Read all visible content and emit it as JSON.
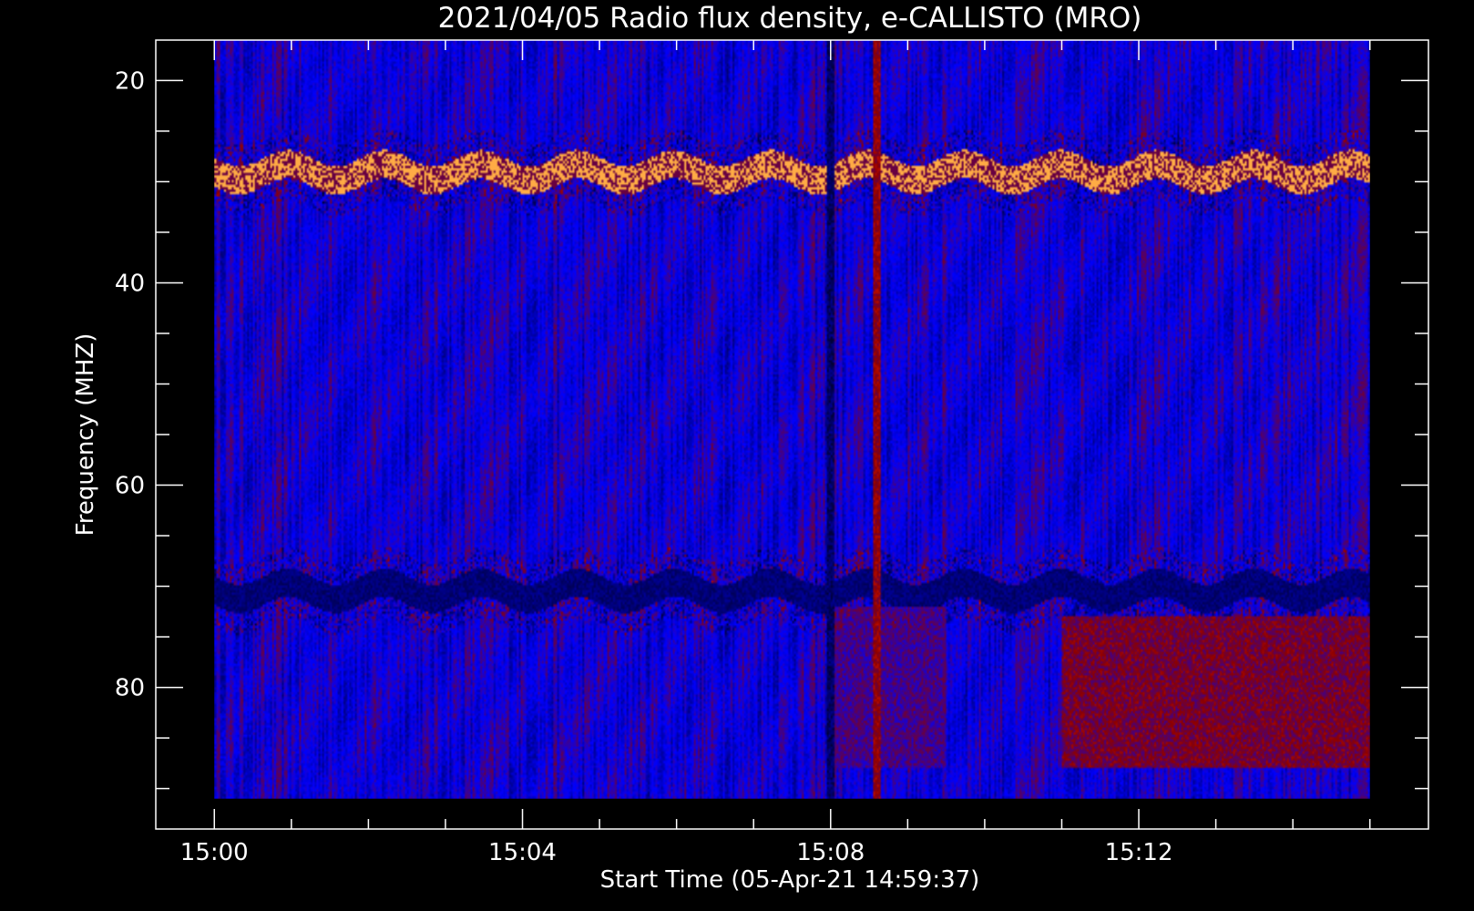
{
  "chart_data": {
    "type": "heatmap",
    "title": "2021/04/05  Radio flux density, e-CALLISTO (MRO)",
    "xlabel": "Start Time (05-Apr-21 14:59:37)",
    "ylabel": "Frequency (MHZ)",
    "x_ticks": [
      {
        "minute": 0,
        "label": "15:00"
      },
      {
        "minute": 4,
        "label": "15:04"
      },
      {
        "minute": 8,
        "label": "15:08"
      },
      {
        "minute": 12,
        "label": "15:12"
      }
    ],
    "y_ticks": [
      {
        "mhz": 20,
        "label": "20"
      },
      {
        "mhz": 40,
        "label": "40"
      },
      {
        "mhz": 60,
        "label": "60"
      },
      {
        "mhz": 80,
        "label": "80"
      }
    ],
    "xlim": [
      -0.76,
      15.76
    ],
    "ylim": [
      16,
      94
    ],
    "data_time_range": [
      0,
      15
    ],
    "data_freq_range": [
      16,
      91
    ],
    "colormap": [
      "#000010",
      "#0000ff",
      "#8c0000",
      "#ff2000",
      "#ffe060"
    ],
    "frame_color": "#ffffff",
    "background": "#000000",
    "features": [
      {
        "kind": "interference-band",
        "freq_mhz": 29,
        "intensity": 0.95,
        "start_min": 0,
        "end_min": 15
      },
      {
        "kind": "interference-band",
        "freq_mhz": 70.5,
        "intensity": 0.1,
        "start_min": 0,
        "end_min": 15
      },
      {
        "kind": "emission-patch",
        "freq_range_mhz": [
          73,
          88
        ],
        "start_min": 11,
        "end_min": 15,
        "intensity": 0.6
      },
      {
        "kind": "emission-patch",
        "freq_range_mhz": [
          72,
          88
        ],
        "start_min": 8,
        "end_min": 9.5,
        "intensity": 0.5
      },
      {
        "kind": "vertical-stripe",
        "time_min": 8,
        "intensity": 0.05
      },
      {
        "kind": "vertical-stripe",
        "time_min": 8.6,
        "intensity": 0.55
      }
    ]
  }
}
